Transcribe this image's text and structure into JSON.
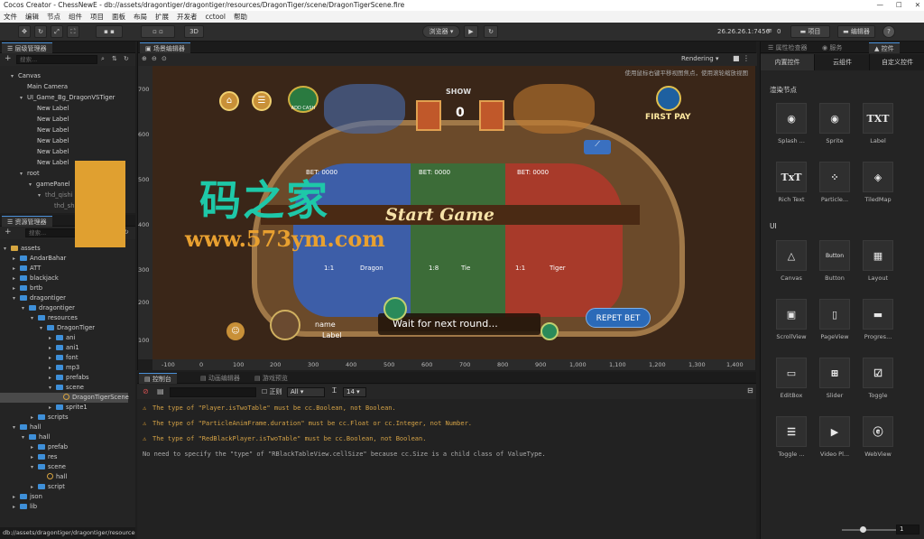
{
  "window": {
    "title": "Cocos Creator - ChessNewE - db://assets/dragontiger/dragontiger/resources/DragonTiger/scene/DragonTigerScene.fire"
  },
  "menu": [
    "文件",
    "编辑",
    "节点",
    "组件",
    "项目",
    "面板",
    "布局",
    "扩展",
    "开发者",
    "cctool",
    "帮助"
  ],
  "toolbar": {
    "mode_3d": "3D",
    "browser": "浏览器 ▾",
    "ip": "26.26.26.1:7456",
    "wifi": "0",
    "project_btn": "项目",
    "editor_btn": "编辑器",
    "help": "?"
  },
  "hierarchy": {
    "tab": "层级管理器",
    "search_placeholder": "搜索...",
    "nodes": [
      "Canvas",
      "Main Camera",
      "UI_Game_Bg_DragonVSTiger",
      "New Label",
      "New Label",
      "New Label",
      "New Label",
      "New Label",
      "New Label",
      "root",
      "gamePanel",
      "thd_qishi",
      "thd_sha"
    ]
  },
  "assets": {
    "tab": "资源管理器",
    "search_placeholder": "搜索...",
    "nodes": [
      "assets",
      "AndarBahar",
      "ATT",
      "blackjack",
      "brtb",
      "dragontiger",
      "dragontiger",
      "resources",
      "DragonTiger",
      "ani",
      "ani1",
      "font",
      "mp3",
      "prefabs",
      "scene",
      "DragonTigerScene",
      "sprite1",
      "scripts",
      "hall",
      "hall",
      "prefab",
      "res",
      "scene",
      "hall",
      "script",
      "json",
      "lib"
    ]
  },
  "status": {
    "path": "db://assets/dragontiger/dragontiger/resources/DragonTiger/scene"
  },
  "scene": {
    "tab": "场景编辑器",
    "render_mode": "Rendering ▾",
    "hint": "使用鼠标右键平移视图焦点，使用滚轮缩放视图",
    "y_ticks": [
      "700",
      "600",
      "500",
      "400",
      "300",
      "200",
      "100"
    ],
    "x_ticks": [
      "-100",
      "0",
      "100",
      "200",
      "300",
      "400",
      "500",
      "600",
      "700",
      "800",
      "900",
      "1,000",
      "1,100",
      "1,200",
      "1,300",
      "1,400"
    ]
  },
  "game": {
    "show": "SHOW",
    "count": "0",
    "first_pay": "FIRST PAY",
    "add_cash": "ADD CASH",
    "bet_left": "BET: 0000",
    "bet_mid": "BET: 0000",
    "bet_right": "BET: 0000",
    "start": "Start Game",
    "odds_dragon": "1:1",
    "label_dragon": "Dragon",
    "odds_tie": "1:8",
    "label_tie": "Tie",
    "odds_tiger": "1:1",
    "label_tiger": "Tiger",
    "wait": "Wait for next round...",
    "repeat": "REPET BET",
    "name": "name",
    "label": "Label"
  },
  "watermark": {
    "title": "码之家",
    "url": "www.573ym.com"
  },
  "console": {
    "tabs": [
      "控制台",
      "动画编辑器",
      "游戏预览"
    ],
    "regex": "正则",
    "level": "All",
    "font_size": "14",
    "logs": [
      {
        "level": "warn",
        "text": "The type of \"Player.isTwoTable\" must be cc.Boolean, not Boolean."
      },
      {
        "level": "warn",
        "text": "The type of \"ParticleAnimFrame.duration\" must be cc.Float or cc.Integer, not Number."
      },
      {
        "level": "warn",
        "text": "The type of \"RedBlackPlayer.isTwoTable\" must be cc.Boolean, not Boolean."
      },
      {
        "level": "info",
        "text": "No need to specify the \"type\" of \"RBlackTableView.cellSize\" because cc.Size is a child class of ValueType."
      }
    ]
  },
  "inspector": {
    "tabs": [
      "属性检查器",
      "服务",
      "控件"
    ],
    "subtabs": [
      "内置控件",
      "云组件",
      "自定义控件"
    ],
    "render_section": "渲染节点",
    "ui_section": "UI",
    "render_items": [
      {
        "label": "Splash ...",
        "glyph": "◉"
      },
      {
        "label": "Sprite",
        "glyph": "◉"
      },
      {
        "label": "Label",
        "glyph": "TXT"
      },
      {
        "label": "Rich Text",
        "glyph": "TxT"
      },
      {
        "label": "Particle...",
        "glyph": "⁘"
      },
      {
        "label": "TiledMap",
        "glyph": "◈"
      }
    ],
    "ui_items": [
      {
        "label": "Canvas",
        "glyph": "△"
      },
      {
        "label": "Button",
        "glyph": "Button"
      },
      {
        "label": "Layout",
        "glyph": "▦"
      },
      {
        "label": "ScrollView",
        "glyph": "▣"
      },
      {
        "label": "PageView",
        "glyph": "▯"
      },
      {
        "label": "Progres...",
        "glyph": "▬"
      },
      {
        "label": "EditBox",
        "glyph": "▭"
      },
      {
        "label": "Slider",
        "glyph": "⊞"
      },
      {
        "label": "Toggle",
        "glyph": "☑"
      },
      {
        "label": "Toggle ...",
        "glyph": "☰"
      },
      {
        "label": "Video Pl...",
        "glyph": "▶"
      },
      {
        "label": "WebView",
        "glyph": "ⓔ"
      }
    ],
    "zoom_value": "1"
  }
}
